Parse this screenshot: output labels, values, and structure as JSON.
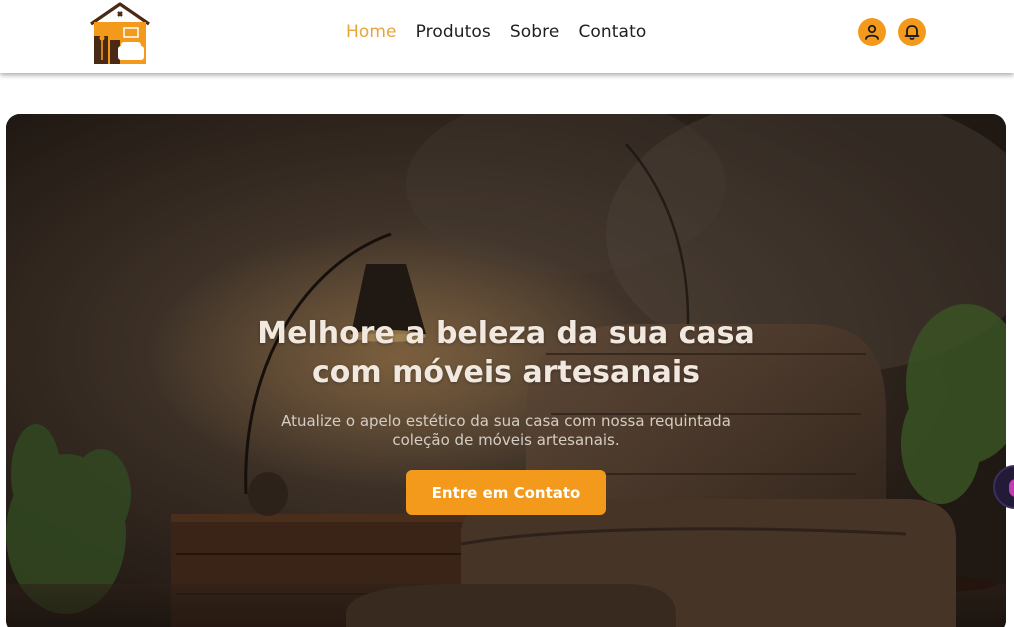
{
  "header": {
    "logo_icon": "house-furniture-logo",
    "nav": [
      {
        "label": "Home",
        "active": true
      },
      {
        "label": "Produtos",
        "active": false
      },
      {
        "label": "Sobre",
        "active": false
      },
      {
        "label": "Contato",
        "active": false
      }
    ],
    "icons": [
      "user-icon",
      "bell-icon"
    ],
    "accent_color": "#f39a1c",
    "active_nav_color": "#e8a43a"
  },
  "hero": {
    "title_line1": "Melhore a beleza da sua casa",
    "title_line2": "com móveis artesanais",
    "subtitle_line1": "Atualize o apelo estético da sua casa com nossa requintada",
    "subtitle_line2": "coleção de móveis artesanais.",
    "cta_label": "Entre em Contato",
    "background_image": "armchair-lamp-living-room"
  }
}
